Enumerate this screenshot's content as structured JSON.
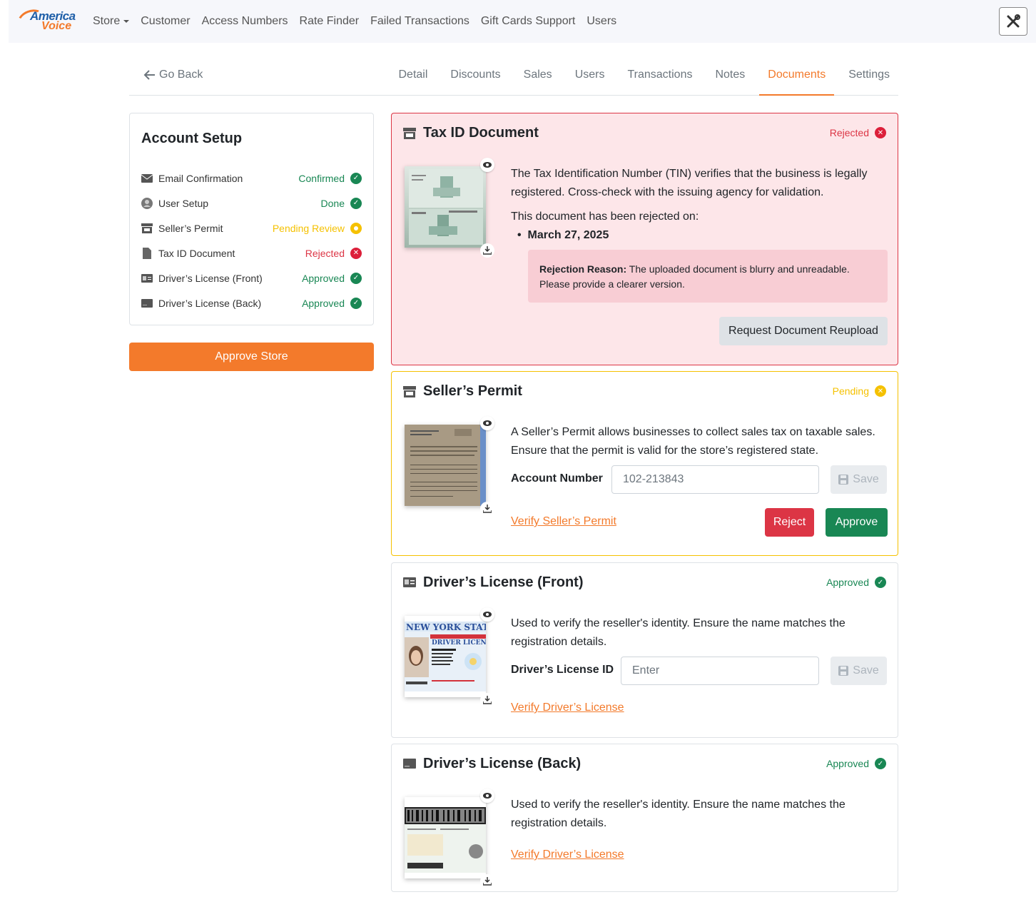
{
  "brand": {
    "line1": "America",
    "line2": "Voice"
  },
  "nav": {
    "items": [
      "Store",
      "Customer",
      "Access Numbers",
      "Rate Finder",
      "Failed Transactions",
      "Gift Cards Support",
      "Users"
    ]
  },
  "page": {
    "go_back": "Go Back",
    "tabs": [
      "Detail",
      "Discounts",
      "Sales",
      "Users",
      "Transactions",
      "Notes",
      "Documents",
      "Settings"
    ],
    "active_tab": "Documents"
  },
  "setup": {
    "title": "Account Setup",
    "items": [
      {
        "label": "Email Confirmation",
        "status": "Confirmed",
        "icon": "envelope-icon"
      },
      {
        "label": "User Setup",
        "status": "Done",
        "icon": "user-circle-icon"
      },
      {
        "label": "Seller’s Permit",
        "status": "Pending Review",
        "icon": "store-icon"
      },
      {
        "label": "Tax ID Document",
        "status": "Rejected",
        "icon": "file-icon"
      },
      {
        "label": "Driver’s License (Front)",
        "status": "Approved",
        "icon": "id-card-icon"
      },
      {
        "label": "Driver’s License (Back)",
        "status": "Approved",
        "icon": "card-back-icon"
      }
    ],
    "approve_label": "Approve Store"
  },
  "colors": {
    "accent": "#f37a2b",
    "success": "#198754",
    "warning": "#f5c100",
    "danger": "#dc3545"
  },
  "taxid": {
    "title": "Tax ID Document",
    "status": "Rejected",
    "description": "The Tax Identification Number (TIN) verifies that the business is legally registered. Cross-check with the issuing agency for validation.",
    "rejected_on_label": "This document has been rejected on:",
    "rejected_date": "March 27, 2025",
    "reason_label": "Rejection Reason:",
    "reason_text": " The uploaded document is blurry and unreadable. Please provide a clearer version.",
    "reupload_label": "Request Document Reupload"
  },
  "permit": {
    "title": "Seller’s Permit",
    "status": "Pending",
    "description": "A Seller’s Permit allows businesses to collect sales tax on taxable sales. Ensure that the permit is valid for the store’s registered state.",
    "field_label": "Account Number",
    "field_value": "102-213843",
    "save_label": "Save",
    "verify_link": "Verify Seller’s Permit",
    "reject_label": "Reject",
    "approve_label": "Approve"
  },
  "dl_front": {
    "title": "Driver’s License (Front)",
    "status": "Approved",
    "description": "Used to verify the reseller's identity. Ensure the name matches the registration details.",
    "field_label": "Driver’s License ID",
    "field_placeholder": "Enter",
    "save_label": "Save",
    "verify_link": "Verify Driver’s License"
  },
  "dl_back": {
    "title": "Driver’s License (Back)",
    "status": "Approved",
    "description": "Used to verify the reseller's identity. Ensure the name matches the registration details.",
    "verify_link": "Verify Driver’s License"
  }
}
